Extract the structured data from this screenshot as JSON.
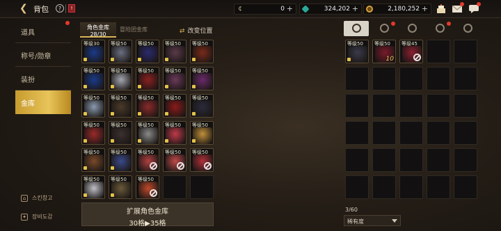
{
  "header": {
    "title": "背包"
  },
  "currency": [
    {
      "icon": "coin-icon",
      "value": "0"
    },
    {
      "icon": "gem-icon",
      "value": "324,202"
    },
    {
      "icon": "gold-icon",
      "value": "2,180,252"
    }
  ],
  "sidebar": {
    "items": [
      {
        "label": "道具"
      },
      {
        "label": "称号/勋章"
      },
      {
        "label": "装扮"
      },
      {
        "label": "金库"
      }
    ],
    "links": [
      {
        "label": "스킨창고"
      },
      {
        "label": "장비도감"
      }
    ]
  },
  "vault": {
    "tabs": [
      {
        "label": "角色金库",
        "count": "28/30"
      },
      {
        "label": "冒险团金库"
      }
    ],
    "swap_label": "改变位置",
    "expand_title": "扩展角色金库",
    "expand_detail": "30格▶35格",
    "items": [
      {
        "level": "等级30",
        "color": "#1b3a8a",
        "lock": true
      },
      {
        "level": "等级50",
        "color": "#6a6e80",
        "lock": true
      },
      {
        "level": "等级50",
        "color": "#2a2a6e",
        "lock": true
      },
      {
        "level": "等级50",
        "color": "#5a3a4a",
        "lock": true
      },
      {
        "level": "等级50",
        "color": "#7a2a1a",
        "lock": true
      },
      {
        "level": "等级50",
        "color": "#1a3a8a",
        "lock": true
      },
      {
        "level": "等级50",
        "color": "#a4a6b0",
        "lock": true
      },
      {
        "level": "等级50",
        "color": "#8a2020",
        "lock": true
      },
      {
        "level": "等级50",
        "color": "#6a3a5a",
        "lock": true
      },
      {
        "level": "等级50",
        "color": "#6a2a6a",
        "lock": true
      },
      {
        "level": "等级50",
        "color": "#8a9ab0",
        "lock": true
      },
      {
        "level": "等级50",
        "color": "#4a3a2a",
        "lock": true
      },
      {
        "level": "等级50",
        "color": "#8a2a2a",
        "lock": true
      },
      {
        "level": "等级50",
        "color": "#8a1a1a",
        "lock": true
      },
      {
        "level": "等级50",
        "color": "#2a2a3a",
        "lock": true
      },
      {
        "level": "等级50",
        "color": "#9a2a2a",
        "lock": true
      },
      {
        "level": "等级50",
        "color": "#3a3030",
        "lock": true
      },
      {
        "level": "等级50",
        "color": "#8a8a8a",
        "lock": true
      },
      {
        "level": "等级50",
        "color": "#c03a4a",
        "lock": true
      },
      {
        "level": "等级50",
        "color": "#c0903a",
        "lock": true
      },
      {
        "level": "等级50",
        "color": "#7a4a2a",
        "lock": true
      },
      {
        "level": "等级50",
        "color": "#3a4a8a",
        "lock": true
      },
      {
        "level": "等级50",
        "color": "#b04040",
        "ban": true
      },
      {
        "level": "等级50",
        "color": "#c04a4a",
        "ban": true
      },
      {
        "level": "等级50",
        "color": "#b0303a",
        "ban": true
      },
      {
        "level": "等级50",
        "color": "#c0c0c8",
        "lock": true
      },
      {
        "level": "等级50",
        "color": "#6a5a3a",
        "lock": true
      },
      {
        "level": "等级50",
        "color": "#c04a2a",
        "ban": true
      },
      {},
      {}
    ]
  },
  "inventory": {
    "tabs": [
      {
        "icon": "weapon-icon",
        "alert": false
      },
      {
        "icon": "potion-icon",
        "alert": true
      },
      {
        "icon": "material-icon",
        "alert": false
      },
      {
        "icon": "card-icon",
        "alert": true
      },
      {
        "icon": "gear-icon",
        "alert": false
      }
    ],
    "count": "3/60",
    "sort_label": "稀有度",
    "items": [
      {
        "level": "等级50",
        "color": "#3a3a4a",
        "lock": true
      },
      {
        "level": "等级50",
        "color": "#7a1a2a",
        "badge": "10"
      },
      {
        "level": "等级45",
        "color": "#8a2030",
        "ban": true
      }
    ]
  }
}
